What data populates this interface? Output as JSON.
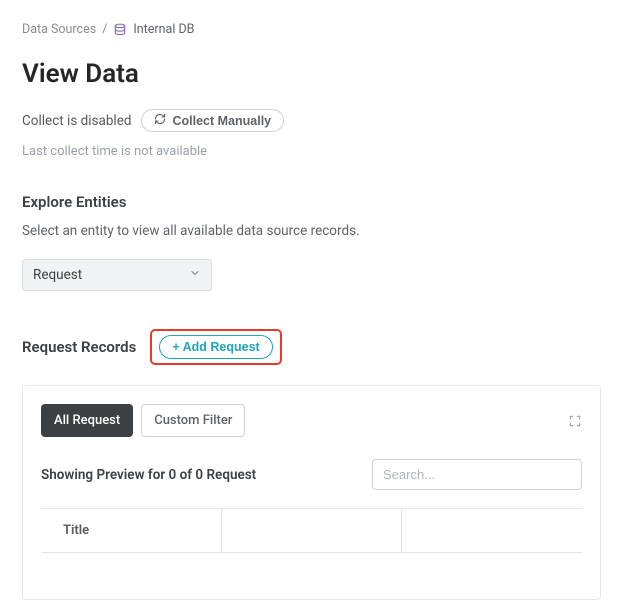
{
  "breadcrumb": {
    "root": "Data Sources",
    "current": "Internal DB"
  },
  "page_title": "View Data",
  "collect": {
    "status": "Collect is disabled",
    "button_label": "Collect Manually",
    "last_time": "Last collect time is not available"
  },
  "explore": {
    "title": "Explore Entities",
    "subtitle": "Select an entity to view all available data source records.",
    "selected": "Request"
  },
  "records": {
    "title": "Request Records",
    "add_button": "+ Add Request",
    "tabs": {
      "active": "All Request",
      "inactive": "Custom Filter"
    },
    "preview_text": "Showing Preview for 0 of 0 Request",
    "search_placeholder": "Search...",
    "columns": [
      "Title",
      "",
      ""
    ]
  }
}
